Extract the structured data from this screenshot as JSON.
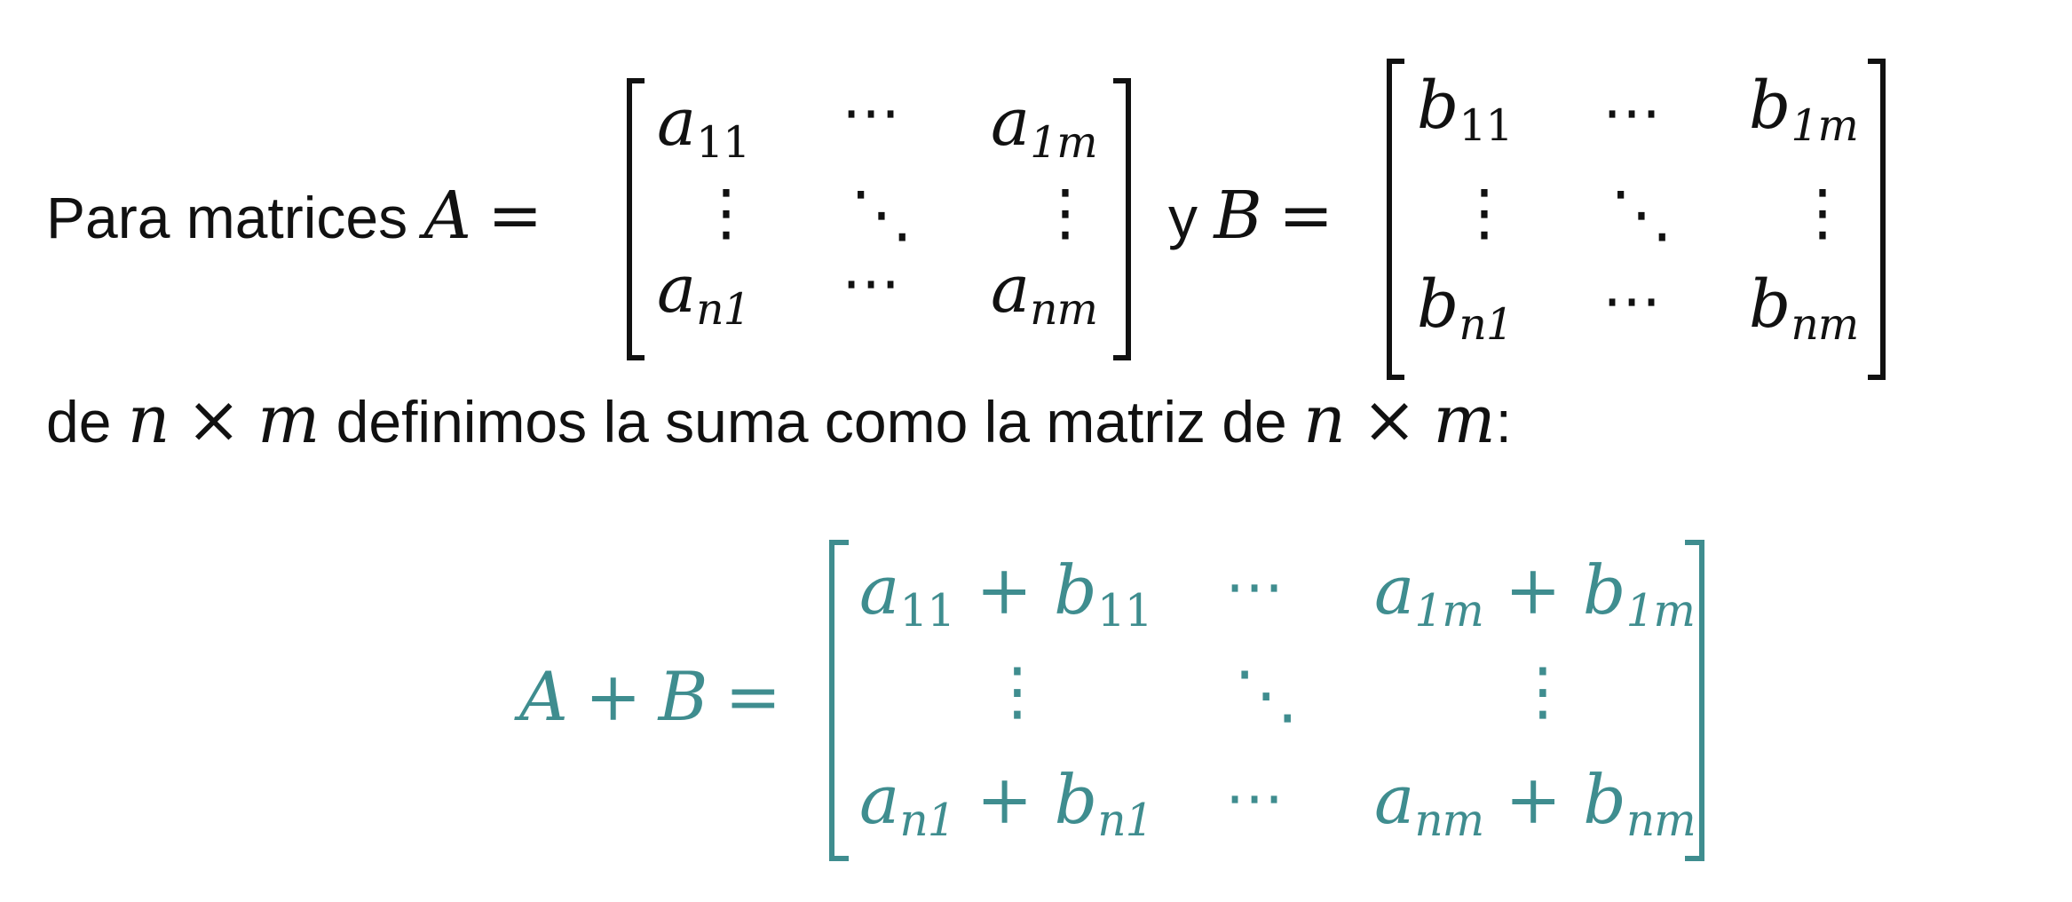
{
  "line1": {
    "intro": "Para matrices",
    "A_label": "A",
    "equals": "=",
    "conj": "y",
    "B_label": "B"
  },
  "matrix_A": {
    "r1c1": {
      "base": "a",
      "sub": "11"
    },
    "r1c2": "⋯",
    "r1c3": {
      "base": "a",
      "sub": "1m"
    },
    "r2c1": "⋮",
    "r2c2": "⋱",
    "r2c3": "⋮",
    "r3c1": {
      "base": "a",
      "sub": "n1"
    },
    "r3c2": "⋯",
    "r3c3": {
      "base": "a",
      "sub": "nm"
    }
  },
  "matrix_B": {
    "r1c1": {
      "base": "b",
      "sub": "11"
    },
    "r1c2": "⋯",
    "r1c3": {
      "base": "b",
      "sub": "1m"
    },
    "r2c1": "⋮",
    "r2c2": "⋱",
    "r2c3": "⋮",
    "r3c1": {
      "base": "b",
      "sub": "n1"
    },
    "r3c2": "⋯",
    "r3c3": {
      "base": "b",
      "sub": "nm"
    }
  },
  "line2": {
    "t1": "de",
    "n": "n",
    "times": "×",
    "m": "m",
    "t2": "definimos la suma como la matriz de",
    "colon": ":"
  },
  "sum": {
    "lhs_A": "A",
    "plus": "+",
    "lhs_B": "B",
    "equals": "=",
    "r1c1": {
      "a": "a",
      "asub": "11",
      "b": "b",
      "bsub": "11"
    },
    "r1c2": "⋯",
    "r1c3": {
      "a": "a",
      "asub": "1m",
      "b": "b",
      "bsub": "1m"
    },
    "r2c1": "⋮",
    "r2c2": "⋱",
    "r2c3": "⋮",
    "r3c1": {
      "a": "a",
      "asub": "n1",
      "b": "b",
      "bsub": "n1"
    },
    "r3c2": "⋯",
    "r3c3": {
      "a": "a",
      "asub": "nm",
      "b": "b",
      "bsub": "nm"
    }
  },
  "colors": {
    "text": "#111111",
    "accent": "#3f8d8f"
  }
}
